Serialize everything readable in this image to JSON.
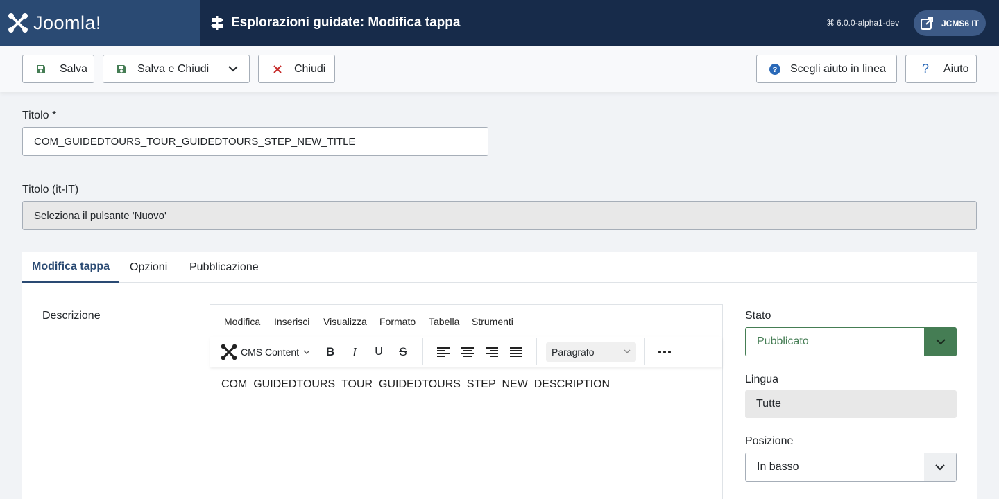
{
  "header": {
    "logo_text": "Joomla!",
    "page_title": "Esplorazioni guidate: Modifica tappa",
    "version": "6.0.0-alpha1-dev",
    "user_label": "JCMS6 IT"
  },
  "toolbar": {
    "save_label": "Salva",
    "save_close_label": "Salva e Chiudi",
    "close_label": "Chiudi",
    "help_select_label": "Scegli aiuto in linea",
    "help_label": "Aiuto"
  },
  "form": {
    "title_label": "Titolo *",
    "title_value": "COM_GUIDEDTOURS_TOUR_GUIDEDTOURS_STEP_NEW_TITLE",
    "title_translated_label": "Titolo (it-IT)",
    "title_translated_value": "Seleziona il pulsante 'Nuovo'"
  },
  "tabs": [
    "Modifica tappa",
    "Opzioni",
    "Pubblicazione"
  ],
  "editor": {
    "field_label": "Descrizione",
    "menu": [
      "Modifica",
      "Inserisci",
      "Visualizza",
      "Formato",
      "Tabella",
      "Strumenti"
    ],
    "cms_content_label": "CMS Content",
    "paragraph_label": "Paragrafo",
    "content": "COM_GUIDEDTOURS_TOUR_GUIDEDTOURS_STEP_NEW_DESCRIPTION"
  },
  "sidebar": {
    "state_label": "Stato",
    "state_value": "Pubblicato",
    "language_label": "Lingua",
    "language_value": "Tutte",
    "position_label": "Posizione",
    "position_value": "In basso"
  },
  "colors": {
    "header_bg": "#172b4a",
    "logo_bg": "#2a4a73",
    "success": "#457d54",
    "danger": "#c52827",
    "info": "#2a69b8"
  }
}
